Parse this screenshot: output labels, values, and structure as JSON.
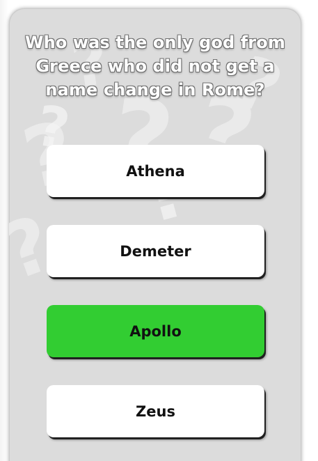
{
  "quiz": {
    "question": "Who was the only god from Greece who did not get a name change in Rome?",
    "answers": [
      {
        "label": "Athena",
        "state": "default"
      },
      {
        "label": "Demeter",
        "state": "default"
      },
      {
        "label": "Apollo",
        "state": "correct"
      },
      {
        "label": "Zeus",
        "state": "default"
      }
    ],
    "background_decoration": "question-marks",
    "colors": {
      "card": "#dcdcdc",
      "answer": "#ffffff",
      "correct": "#32cd32",
      "question_text": "#ffffff"
    }
  }
}
